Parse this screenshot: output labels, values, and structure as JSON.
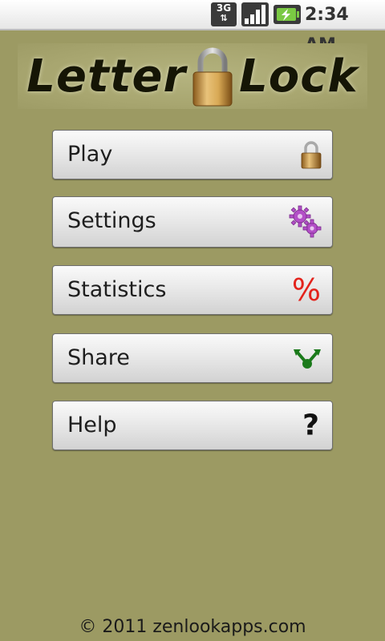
{
  "status_bar": {
    "network": "3G",
    "network_arrows": "⇅",
    "signal_icon": "signal-bars-icon",
    "battery_icon": "battery-charging-icon",
    "time": "2:34 AM"
  },
  "logo": {
    "word_left": "Letter",
    "word_right": "Lock",
    "lock_icon": "padlock-icon"
  },
  "menu": {
    "play": {
      "label": "Play",
      "icon": "padlock-icon"
    },
    "settings": {
      "label": "Settings",
      "icon": "gears-icon"
    },
    "statistics": {
      "label": "Statistics",
      "icon": "percent-icon",
      "glyph": "%"
    },
    "share": {
      "label": "Share",
      "icon": "share-icon"
    },
    "help": {
      "label": "Help",
      "icon": "question-icon",
      "glyph": "?"
    }
  },
  "colors": {
    "background": "#9c9a63",
    "percent_red": "#e3231c",
    "share_green": "#1b7a1b",
    "gear_purple": "#b34fc7",
    "lock_gold": "#d2a54f"
  },
  "footer": {
    "copyright": "© 2011 zenlookapps.com"
  }
}
